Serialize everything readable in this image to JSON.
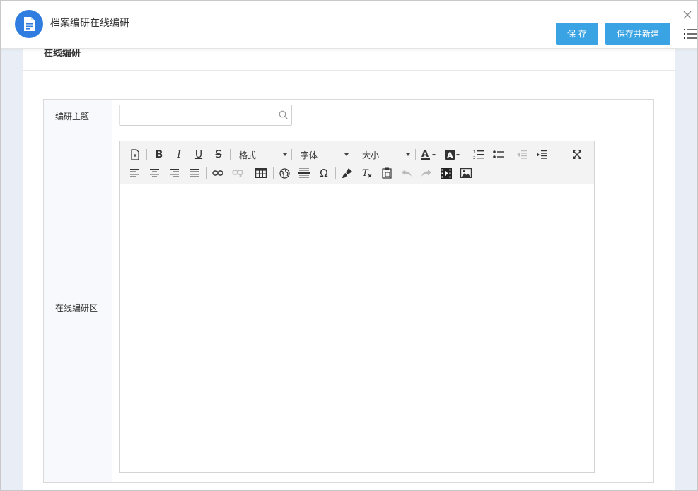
{
  "window": {
    "title": "档案编研在线编研",
    "save_label": "保 存",
    "save_new_label": "保存并新建"
  },
  "panel": {
    "title": "在线编研"
  },
  "form": {
    "topic_label": "编研主题",
    "topic_value": "",
    "editor_label": "在线编研区"
  },
  "toolbar": {
    "format_label": "格式",
    "font_label": "字体",
    "size_label": "大小",
    "buttons_row1": [
      "new-document",
      "bold",
      "italic",
      "underline",
      "strikethrough",
      "format",
      "font",
      "size",
      "text-color",
      "background-color",
      "ordered-list",
      "unordered-list",
      "outdent",
      "indent",
      "maximize"
    ],
    "buttons_row2": [
      "align-left",
      "align-center",
      "align-right",
      "align-justify",
      "link",
      "unlink",
      "table",
      "globe",
      "horizontal-rule",
      "special-char",
      "paint-brush",
      "remove-format",
      "paste",
      "undo",
      "redo",
      "video",
      "image"
    ]
  },
  "colors": {
    "primary": "#3aa3e3",
    "app_icon": "#2f7de1",
    "background": "#e9eef6"
  }
}
